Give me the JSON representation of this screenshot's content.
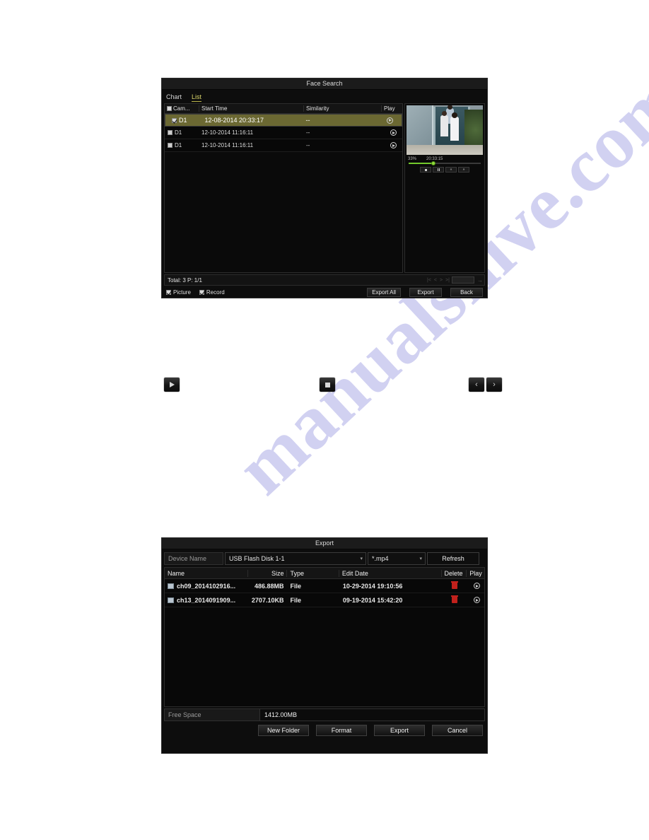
{
  "watermark": {
    "text": "manualshive.com"
  },
  "face_search": {
    "title": "Face Search",
    "tabs": [
      {
        "label": "Chart",
        "active": false
      },
      {
        "label": "List",
        "active": true
      }
    ],
    "columns": {
      "camera": "Cam...",
      "start_time": "Start Time",
      "similarity": "Similarity",
      "play": "Play"
    },
    "rows": [
      {
        "camera": "D1",
        "start_time": "12-08-2014 20:33:17",
        "similarity": "--",
        "checked": true,
        "selected": true
      },
      {
        "camera": "D1",
        "start_time": "12-10-2014 11:16:11",
        "similarity": "--",
        "checked": false,
        "selected": false
      },
      {
        "camera": "D1",
        "start_time": "12-10-2014 11:16:11",
        "similarity": "--",
        "checked": false,
        "selected": false
      }
    ],
    "preview": {
      "percent": "33%",
      "timestamp": "20:33:15",
      "controls": [
        "stop-button",
        "pause-button",
        "slow-button",
        "fast-forward-button"
      ]
    },
    "footer": {
      "total": "Total: 3  P: 1/1",
      "page_input": "",
      "nav": [
        "first-page",
        "prev-page",
        "next-page",
        "last-page"
      ],
      "go": "go"
    },
    "options": [
      {
        "label": "Picture",
        "checked": true
      },
      {
        "label": "Record",
        "checked": true
      }
    ],
    "buttons": [
      {
        "label": "Export All",
        "name": "export-all-button"
      },
      {
        "label": "Export",
        "name": "export-button"
      },
      {
        "label": "Back",
        "name": "back-button"
      }
    ]
  },
  "inline_icons": [
    {
      "name": "play-icon-button",
      "glyph": "play"
    },
    {
      "name": "stop-icon-button",
      "glyph": "stop"
    },
    {
      "name": "prev-icon-button",
      "glyph": "‹"
    },
    {
      "name": "next-icon-button",
      "glyph": "›"
    }
  ],
  "export_dialog": {
    "title": "Export",
    "device_label": "Device Name",
    "device_value": "USB Flash Disk 1-1",
    "filetype_value": "*.mp4",
    "refresh_label": "Refresh",
    "columns": {
      "name": "Name",
      "size": "Size",
      "type": "Type",
      "edit_date": "Edit Date",
      "delete": "Delete",
      "play": "Play"
    },
    "rows": [
      {
        "name": "ch09_2014102916...",
        "size": "486.88MB",
        "type": "File",
        "edit_date": "10-29-2014 19:10:56"
      },
      {
        "name": "ch13_2014091909...",
        "size": "2707.10KB",
        "type": "File",
        "edit_date": "09-19-2014 15:42:20"
      }
    ],
    "free_space_label": "Free Space",
    "free_space_value": "1412.00MB",
    "buttons": [
      {
        "label": "New Folder",
        "name": "new-folder-button"
      },
      {
        "label": "Format",
        "name": "format-button"
      },
      {
        "label": "Export",
        "name": "export-button"
      },
      {
        "label": "Cancel",
        "name": "cancel-button"
      }
    ]
  },
  "colors": {
    "accent_tab": "#d9d56a",
    "selected_row": "#6b6832",
    "progress": "#73c92c",
    "delete": "#c1211c",
    "watermark": "#c9c9ef"
  }
}
